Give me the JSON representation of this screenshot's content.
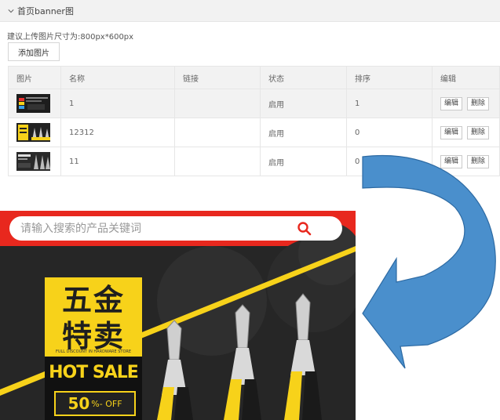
{
  "section": {
    "title": "首页banner图",
    "chevron_icon": "chevron-down-icon"
  },
  "hint": "建议上传图片尺寸为:800px*600px",
  "add_button": "添加图片",
  "table": {
    "headers": [
      "图片",
      "名称",
      "链接",
      "状态",
      "排序",
      "编辑"
    ],
    "rows": [
      {
        "name": "1",
        "link": "",
        "status": "启用",
        "order": "1",
        "edit": "编辑",
        "delete": "删除"
      },
      {
        "name": "12312",
        "link": "",
        "status": "启用",
        "order": "0",
        "edit": "编辑",
        "delete": "删除"
      },
      {
        "name": "11",
        "link": "",
        "status": "启用",
        "order": "0",
        "edit": "编辑",
        "delete": "删除"
      }
    ]
  },
  "preview": {
    "search_placeholder": "请输入搜索的产品关键词",
    "search_icon": "search-icon",
    "title_line1": "五金",
    "title_line2": "特卖",
    "subtitle": "FULL DISCOUNT IN HARDWARE STORE",
    "hot_sale": "HOT SALE",
    "discount_num": "50",
    "discount_text": "%- OFF"
  },
  "colors": {
    "red_bar": "#e8281e",
    "yellow": "#f7d21a",
    "arrow_blue": "#4a8fcc"
  }
}
